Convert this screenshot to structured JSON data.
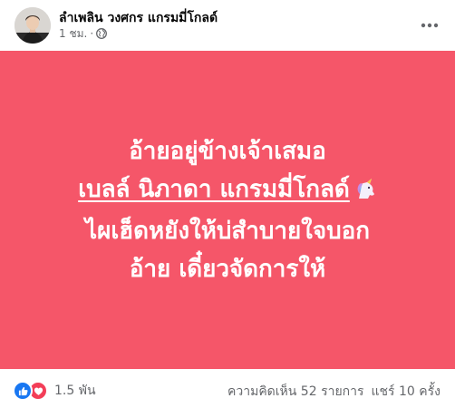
{
  "post": {
    "author": "ลำเพลิน วงศกร แกรมมี่โกลด์",
    "time": "1 ชม.",
    "separator": "·",
    "privacy_icon": "globe-icon",
    "more_icon": "more-dots-icon",
    "background_color": "#f55669",
    "text_lines": [
      "อ้ายอยู่ข้างเจ้าเสมอ",
      "เบลล์ นิภาดา แกรมมี่โกลด์",
      "ไผเฮ็ดหยังให้บ่สำบายใจบอก",
      "อ้าย เดี๋ยวจัดการให้"
    ],
    "emoji": "unicorn-icon"
  },
  "footer": {
    "reaction_icons": [
      "like-icon",
      "love-icon"
    ],
    "reaction_count": "1.5 พัน",
    "comments": "ความคิดเห็น 52 รายการ",
    "shares": "แชร์ 10 ครั้ง"
  }
}
